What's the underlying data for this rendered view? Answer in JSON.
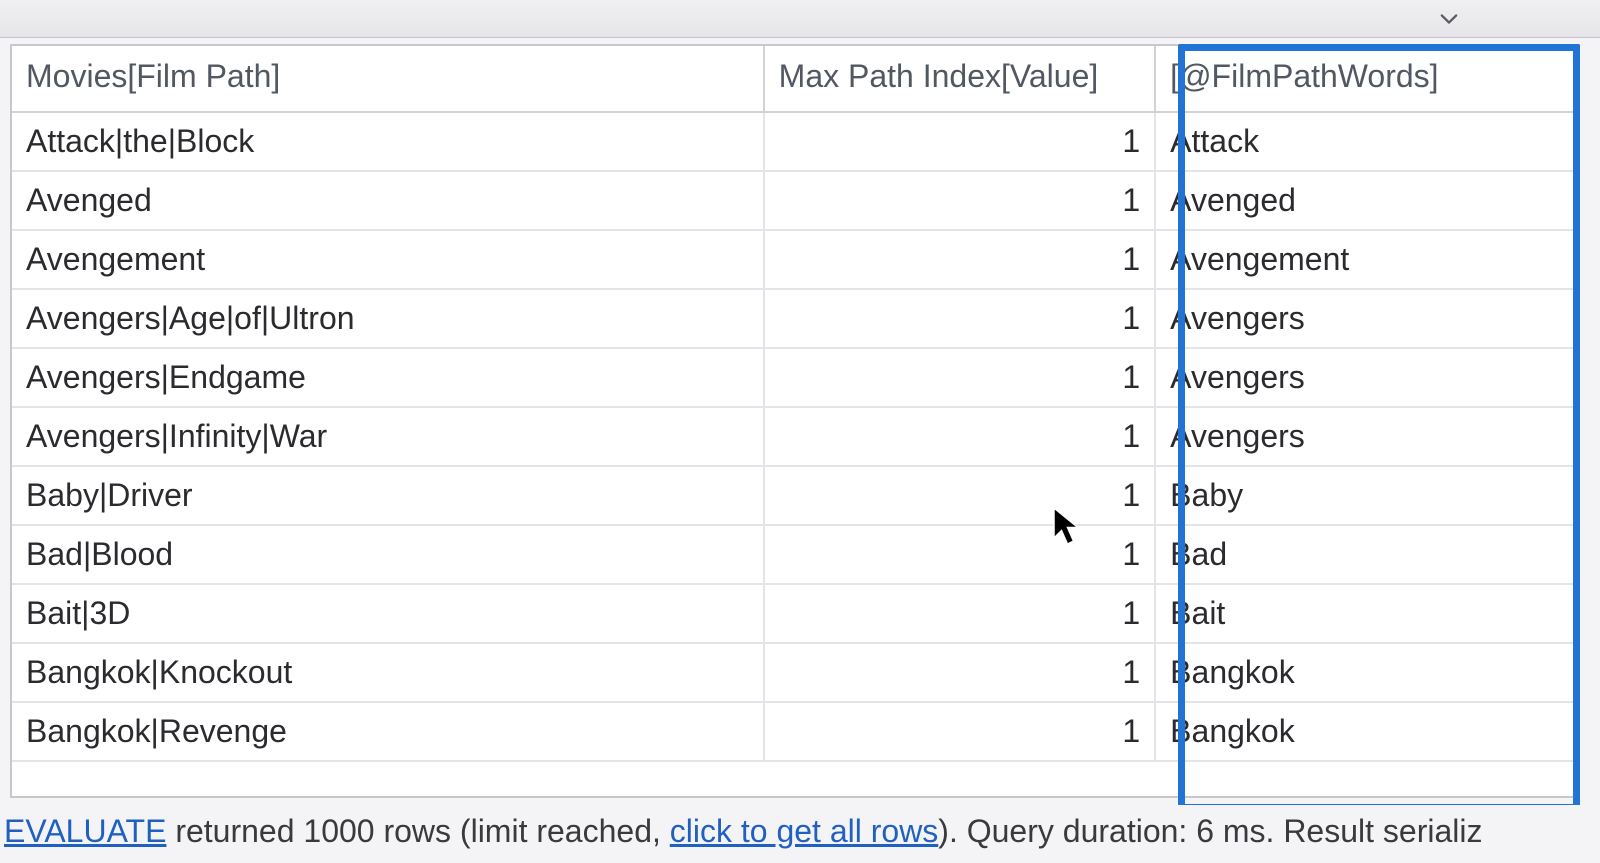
{
  "columns": {
    "filmPath": "Movies[Film Path]",
    "maxIndex": "Max Path Index[Value]",
    "words": "[@FilmPathWords]"
  },
  "rows": [
    {
      "filmPath": "Attack|the|Block",
      "maxIndex": "1",
      "words": "Attack"
    },
    {
      "filmPath": "Avenged",
      "maxIndex": "1",
      "words": "Avenged"
    },
    {
      "filmPath": "Avengement",
      "maxIndex": "1",
      "words": "Avengement"
    },
    {
      "filmPath": "Avengers|Age|of|Ultron",
      "maxIndex": "1",
      "words": "Avengers"
    },
    {
      "filmPath": "Avengers|Endgame",
      "maxIndex": "1",
      "words": "Avengers"
    },
    {
      "filmPath": "Avengers|Infinity|War",
      "maxIndex": "1",
      "words": "Avengers"
    },
    {
      "filmPath": "Baby|Driver",
      "maxIndex": "1",
      "words": "Baby"
    },
    {
      "filmPath": "Bad|Blood",
      "maxIndex": "1",
      "words": "Bad"
    },
    {
      "filmPath": "Bait|3D",
      "maxIndex": "1",
      "words": "Bait"
    },
    {
      "filmPath": "Bangkok|Knockout",
      "maxIndex": "1",
      "words": "Bangkok"
    },
    {
      "filmPath": "Bangkok|Revenge",
      "maxIndex": "1",
      "words": "Bangkok"
    }
  ],
  "status": {
    "evaluateLabel": "EVALUATE",
    "part1": " returned 1000 rows (limit reached, ",
    "clickAllRows": "click to get all rows",
    "part2": "). Query duration: 6 ms. Result serializ"
  }
}
